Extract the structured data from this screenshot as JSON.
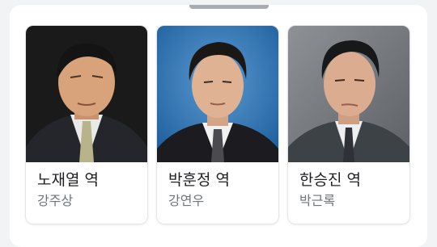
{
  "cast": [
    {
      "role": "노재열 역",
      "actor": "강주상",
      "photo_icon": "portrait-photo"
    },
    {
      "role": "박훈정 역",
      "actor": "강연우",
      "photo_icon": "portrait-photo"
    },
    {
      "role": "한승진 역",
      "actor": "박근록",
      "photo_icon": "portrait-photo"
    }
  ],
  "colors": {
    "card_background": "#ffffff",
    "role_text": "#202124",
    "actor_text": "#70757a",
    "page_background": "#f1f3f4"
  }
}
